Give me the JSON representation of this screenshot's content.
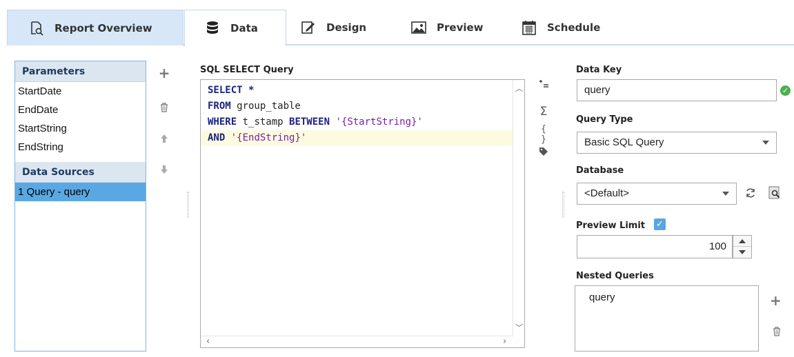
{
  "tabs": [
    {
      "label": "Report Overview",
      "icon": "report-magnifier-icon"
    },
    {
      "label": "Data",
      "icon": "database-icon"
    },
    {
      "label": "Design",
      "icon": "edit-pencil-icon"
    },
    {
      "label": "Preview",
      "icon": "image-icon"
    },
    {
      "label": "Schedule",
      "icon": "calendar-icon"
    }
  ],
  "active_tab": "Data",
  "left_panel": {
    "parameters_header": "Parameters",
    "parameters": [
      "StartDate",
      "EndDate",
      "StartString",
      "EndString"
    ],
    "data_sources_header": "Data Sources",
    "data_sources": [
      "1 Query - query"
    ],
    "selected_data_source": "1 Query - query"
  },
  "sql": {
    "label": "SQL SELECT Query",
    "lines": [
      [
        {
          "t": "SELECT ",
          "k": "kw"
        },
        {
          "t": "*",
          "k": "kw"
        }
      ],
      [
        {
          "t": "FROM",
          "k": "kw"
        },
        {
          "t": " group_table",
          "k": "plain"
        }
      ],
      [
        {
          "t": "WHERE",
          "k": "kw"
        },
        {
          "t": " t_stamp ",
          "k": "plain"
        },
        {
          "t": "BETWEEN",
          "k": "kw"
        },
        {
          "t": " ",
          "k": "plain"
        },
        {
          "t": "'{StartString}'",
          "k": "str"
        }
      ],
      [
        {
          "t": "AND",
          "k": "kw"
        },
        {
          "t": " ",
          "k": "plain"
        },
        {
          "t": "'{EndString}'",
          "k": "str"
        }
      ]
    ]
  },
  "props": {
    "data_key_label": "Data Key",
    "data_key_value": "query",
    "query_type_label": "Query Type",
    "query_type_value": "Basic SQL Query",
    "database_label": "Database",
    "database_value": "<Default>",
    "preview_limit_label": "Preview Limit",
    "preview_limit_checked": true,
    "preview_limit_value": "100",
    "nested_queries_label": "Nested Queries",
    "nested_queries": [
      "query"
    ]
  },
  "colors": {
    "selection": "#59a8e4",
    "header_bg": "#dce6f1",
    "tab_bg": "#d7e7f8",
    "keyword": "#1a237e",
    "string": "#7a1fa2",
    "ok": "#4caf50"
  }
}
